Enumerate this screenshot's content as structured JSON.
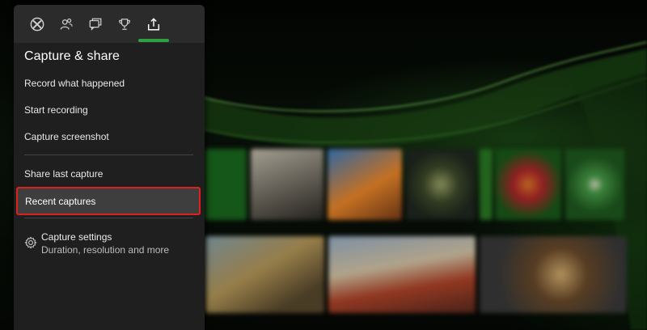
{
  "guide": {
    "tabs": [
      {
        "icon": "xbox-logo-icon"
      },
      {
        "icon": "people-icon"
      },
      {
        "icon": "chat-icon"
      },
      {
        "icon": "trophy-icon"
      },
      {
        "icon": "share-icon",
        "selected": true
      }
    ],
    "section_title": "Capture & share",
    "items": {
      "record_what_happened": "Record what happened",
      "start_recording": "Start recording",
      "capture_screenshot": "Capture screenshot",
      "share_last_capture": "Share last capture",
      "recent_captures": "Recent captures"
    },
    "settings": {
      "title": "Capture settings",
      "description": "Duration, resolution and more"
    }
  },
  "colors": {
    "accent_green": "#2ea043",
    "highlight_red": "#e0201a",
    "panel_bg": "#1f1f1f",
    "tab_bar_bg": "#2b2b2b"
  }
}
